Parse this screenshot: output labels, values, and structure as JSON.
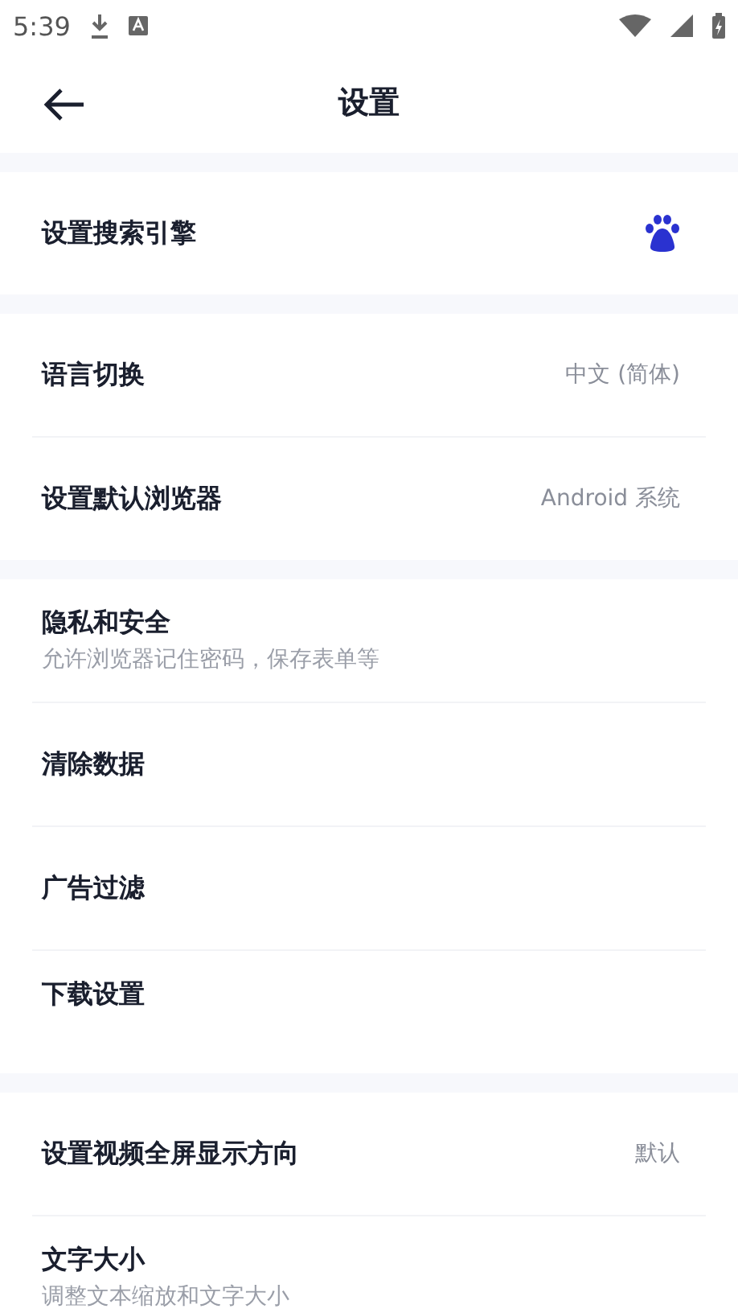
{
  "status_bar": {
    "time": "5:39"
  },
  "header": {
    "title": "设置"
  },
  "sections": [
    {
      "rows": [
        {
          "kind": "icon",
          "label": "设置搜索引擎"
        }
      ]
    },
    {
      "rows": [
        {
          "kind": "value",
          "label": "语言切换",
          "value": "中文 (简体)"
        },
        {
          "kind": "value",
          "label": "设置默认浏览器",
          "value": "Android 系统"
        }
      ]
    },
    {
      "rows": [
        {
          "kind": "subtitle",
          "label": "隐私和安全",
          "subtitle": "允许浏览器记住密码，保存表单等"
        },
        {
          "kind": "plain",
          "label": "清除数据"
        },
        {
          "kind": "plain",
          "label": "广告过滤"
        },
        {
          "kind": "plain",
          "label": "下载设置"
        }
      ]
    },
    {
      "rows": [
        {
          "kind": "value",
          "label": "设置视频全屏显示方向",
          "value": "默认"
        },
        {
          "kind": "subtitle",
          "label": "文字大小",
          "subtitle": "调整文本缩放和文字大小"
        }
      ]
    }
  ]
}
